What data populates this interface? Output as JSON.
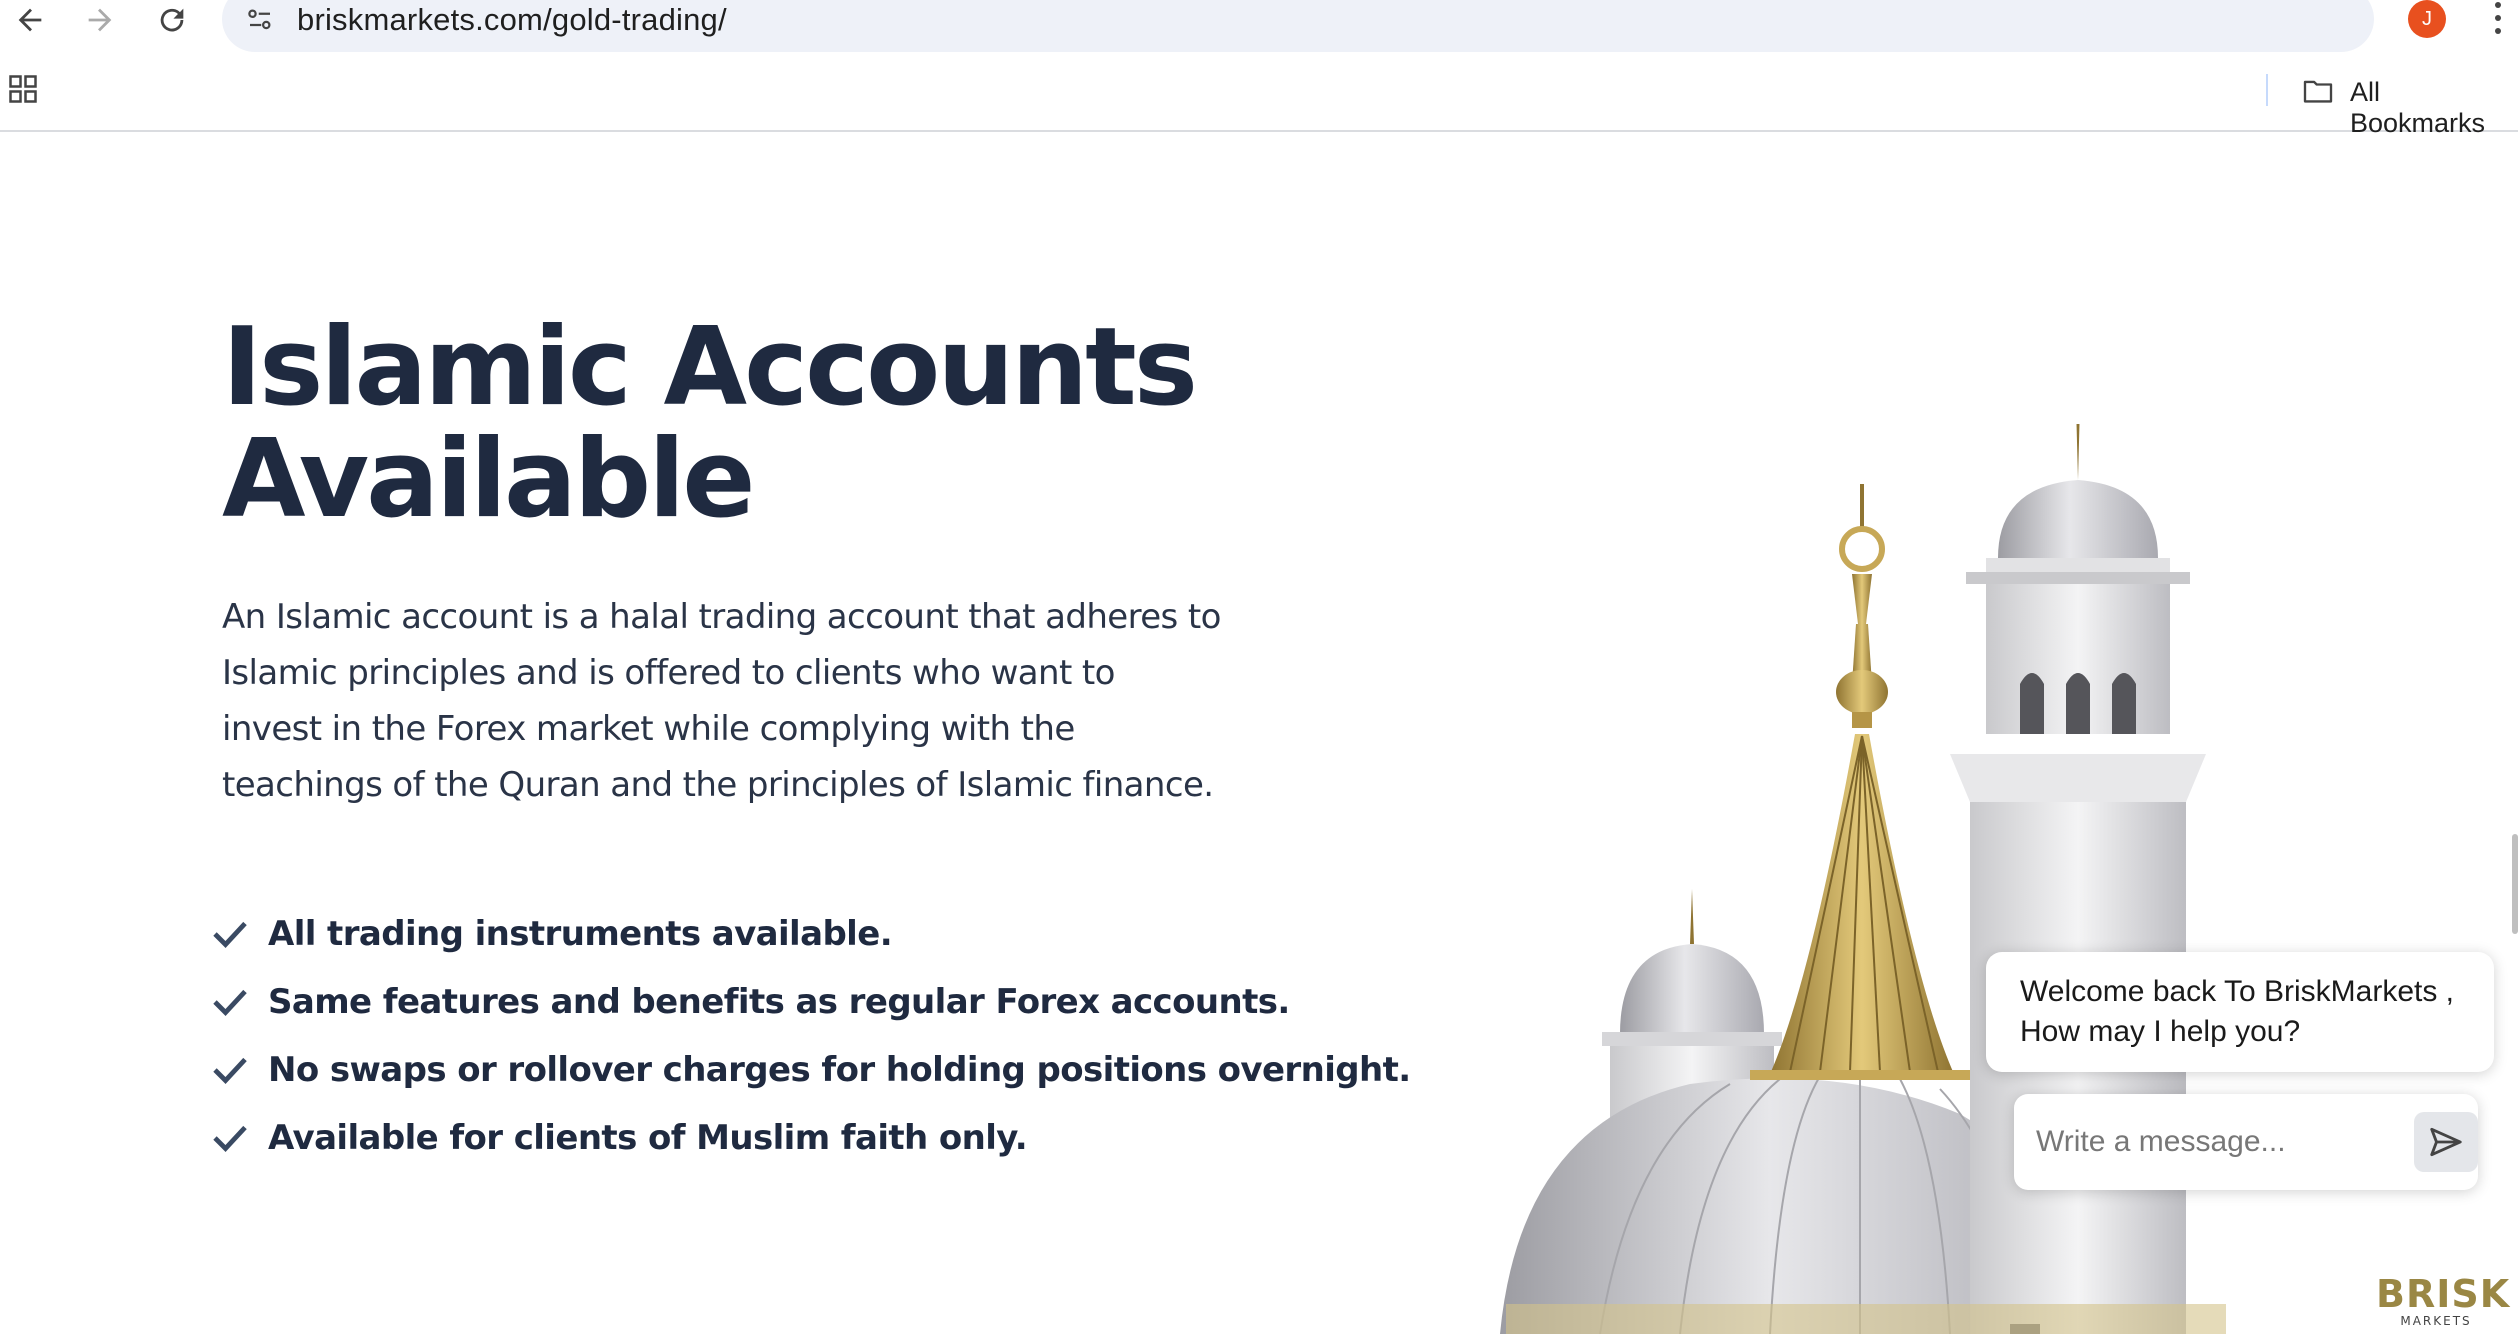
{
  "browser": {
    "url": "briskmarkets.com/gold-trading/",
    "profile_initial": "J",
    "bookmarks_label": "All Bookmarks",
    "accent": "#e8501f"
  },
  "hero": {
    "title_line1": "Islamic Accounts",
    "title_line2": "Available",
    "intro": "An Islamic account is a halal trading account that adheres to Islamic principles and is offered to clients who want to invest in the Forex market while complying with the teachings of the Quran and the principles of Islamic finance."
  },
  "features": [
    "All trading instruments available.",
    "Same features and benefits as regular Forex accounts.",
    "No swaps or rollover charges for holding positions overnight.",
    "Available for clients of Muslim faith only."
  ],
  "chat": {
    "welcome_line1": "Welcome back To BriskMarkets ,",
    "welcome_line2": "How may I help you?",
    "placeholder": "Write a message..."
  },
  "logo": {
    "word": "BRISK",
    "sub": "MARKETS"
  },
  "colors": {
    "heading": "#1f2a40",
    "check": "#3a4a63",
    "gold": "#9a8744"
  }
}
